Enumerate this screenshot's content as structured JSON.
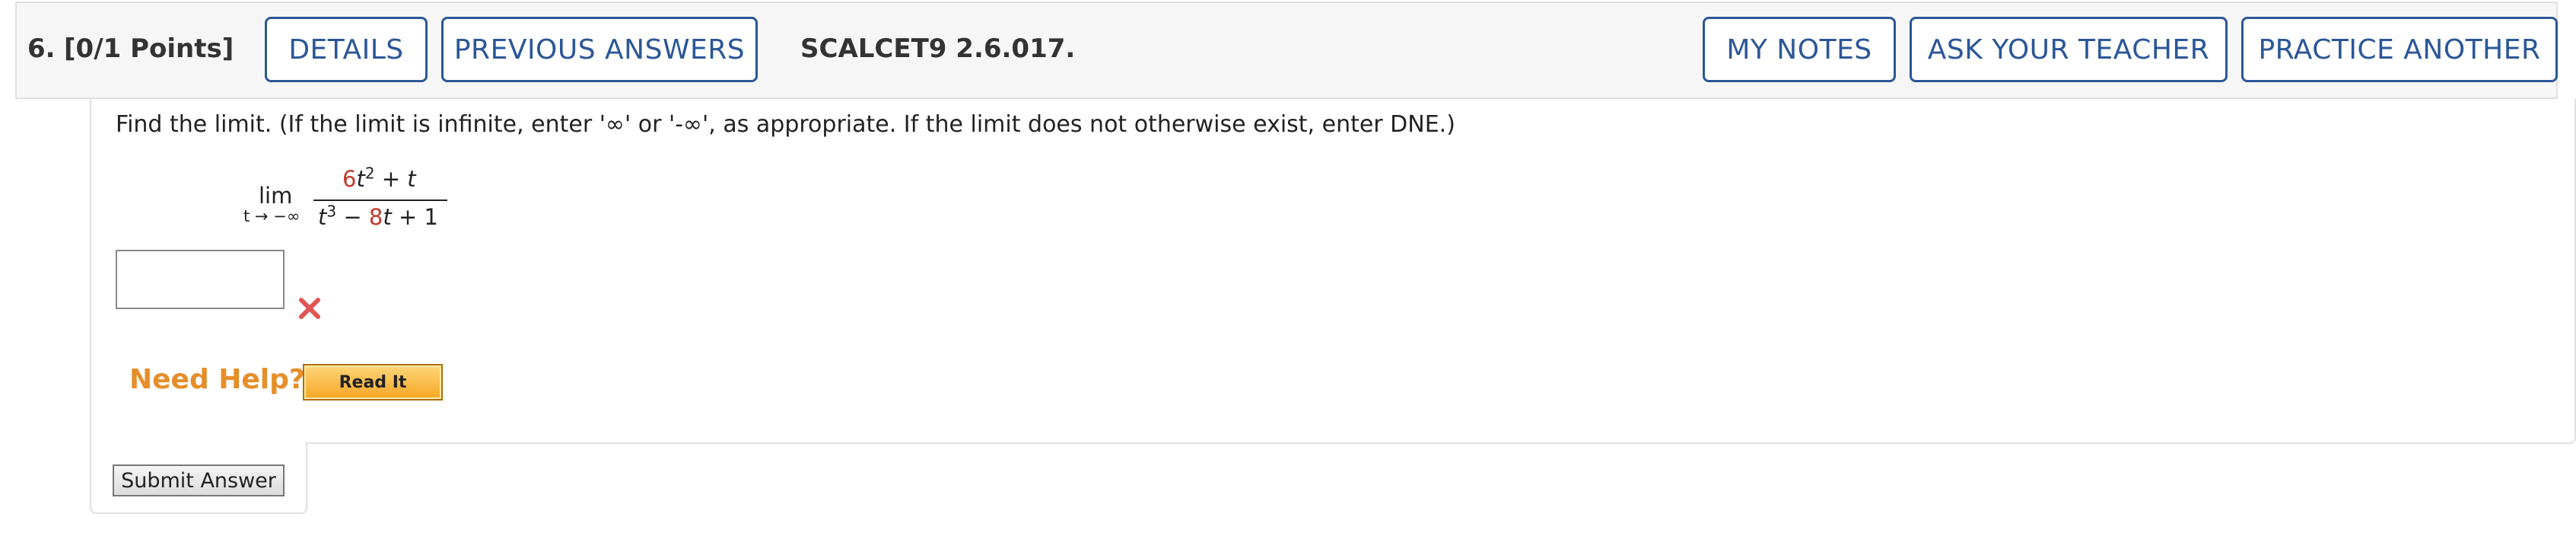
{
  "question": {
    "number": "6.",
    "points": "[0/1 Points]",
    "code": "SCALCET9 2.6.017."
  },
  "header_buttons": {
    "details": "DETAILS",
    "previous_answers": "PREVIOUS ANSWERS",
    "my_notes": "MY NOTES",
    "ask_teacher": "ASK YOUR TEACHER",
    "practice_another": "PRACTICE ANOTHER"
  },
  "instructions": "Find the limit. (If the limit is infinite, enter '∞' or '-∞', as appropriate. If the limit does not otherwise exist, enter DNE.)",
  "math": {
    "lim_word": "lim",
    "lim_subscript": "t → −∞",
    "num_coef": "6",
    "num_var": "t",
    "num_exp": "2",
    "num_rest": " + t",
    "den_var": "t",
    "den_exp": "3",
    "den_minus": " − ",
    "den_coef": "8",
    "den_var2": "t",
    "den_rest": " + 1"
  },
  "answer": {
    "value": "",
    "status": "incorrect",
    "status_icon": "x-mark-icon",
    "status_color": "#e05555"
  },
  "help": {
    "label": "Need Help?",
    "read_it": "Read It"
  },
  "submit_label": "Submit Answer",
  "colors": {
    "accent": "#2b5797",
    "help_orange": "#e58e2a",
    "highlight_red": "#c0392b"
  }
}
